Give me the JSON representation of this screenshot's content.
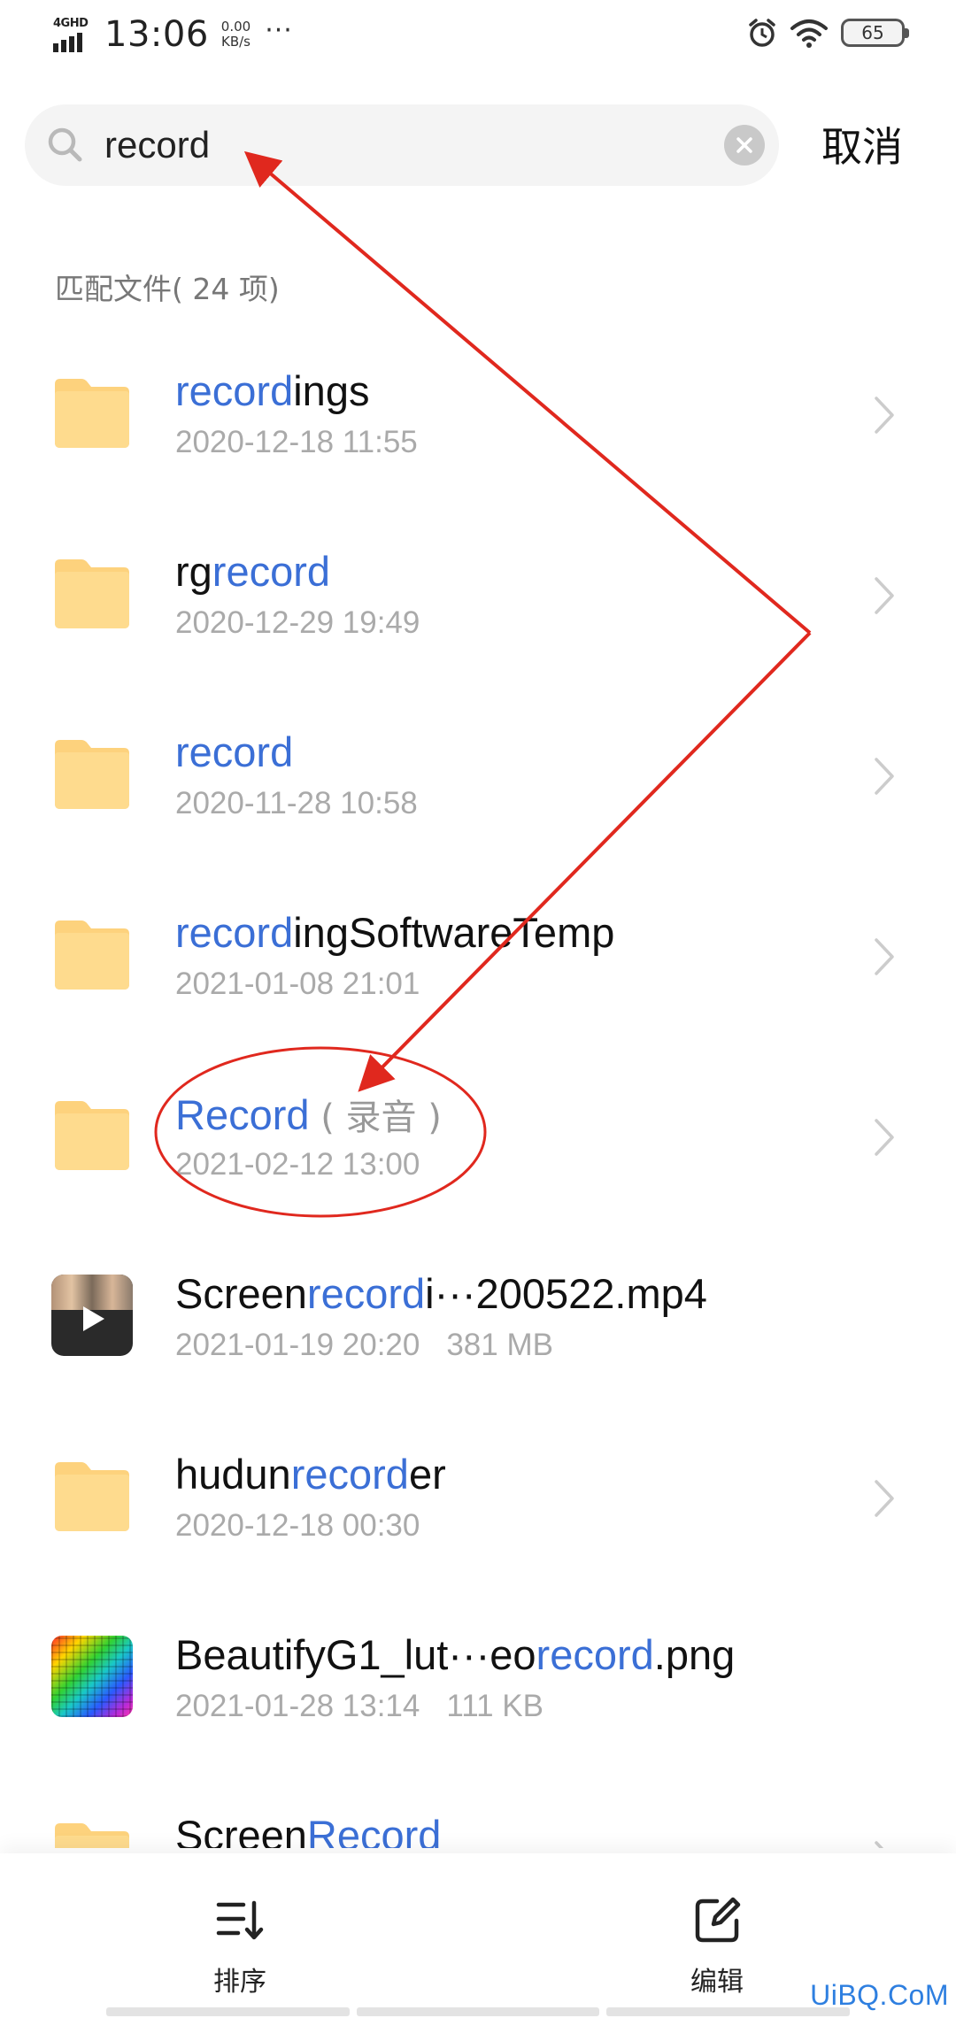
{
  "status_bar": {
    "network": "4GHD",
    "time": "13:06",
    "speed_value": "0.00",
    "speed_unit": "KB/s",
    "more": "···",
    "battery": "65"
  },
  "search": {
    "query": "record",
    "cancel_label": "取消"
  },
  "results_header": "匹配文件( 24 项)",
  "files": [
    {
      "name_pre": "",
      "name_hl": "record",
      "name_post": "ings",
      "suffix": "",
      "date": "2020-12-18 11:55",
      "size": "",
      "type": "folder"
    },
    {
      "name_pre": "rg",
      "name_hl": "record",
      "name_post": "",
      "suffix": "",
      "date": "2020-12-29 19:49",
      "size": "",
      "type": "folder"
    },
    {
      "name_pre": "",
      "name_hl": "record",
      "name_post": "",
      "suffix": "",
      "date": "2020-11-28 10:58",
      "size": "",
      "type": "folder"
    },
    {
      "name_pre": "",
      "name_hl": "record",
      "name_post": "ingSoftwareTemp",
      "suffix": "",
      "date": "2021-01-08 21:01",
      "size": "",
      "type": "folder"
    },
    {
      "name_pre": "",
      "name_hl": "Record",
      "name_post": "",
      "suffix": " ( 录音 )",
      "date": "2021-02-12 13:00",
      "size": "",
      "type": "folder"
    },
    {
      "name_pre": "Screen",
      "name_hl": "record",
      "name_post": "i···200522.mp4",
      "suffix": "",
      "date": "2021-01-19 20:20",
      "size": "381 MB",
      "type": "video"
    },
    {
      "name_pre": "hudun",
      "name_hl": "record",
      "name_post": "er",
      "suffix": "",
      "date": "2020-12-18 00:30",
      "size": "",
      "type": "folder"
    },
    {
      "name_pre": "BeautifyG1_lut···eo",
      "name_hl": "record",
      "name_post": ".png",
      "suffix": "",
      "date": "2021-01-28 13:14",
      "size": "111 KB",
      "type": "image"
    },
    {
      "name_pre": "Screen",
      "name_hl": "Record",
      "name_post": "",
      "suffix": "",
      "date": "",
      "size": "",
      "type": "folder"
    }
  ],
  "toolbar": {
    "sort_label": "排序",
    "edit_label": "编辑"
  },
  "watermark": "UiBQ.CoM",
  "colors": {
    "highlight": "#3b6fd6",
    "folder": "#fdd27d",
    "annotation": "#e0281e"
  }
}
